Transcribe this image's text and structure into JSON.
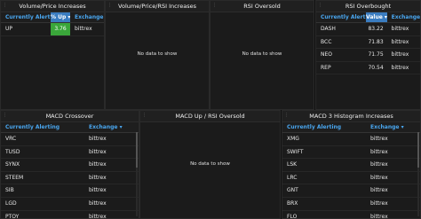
{
  "colors": {
    "accent": "#3a7cc0",
    "header_text": "#49a6ef",
    "positive": "#3aa63a"
  },
  "panels": {
    "vol_price": {
      "title": "Volume/Price Increases",
      "col1": "Currently Alerting",
      "col2": "% Up ▾",
      "col3": "Exchange",
      "rows": [
        {
          "coin": "UP",
          "value": "3.76",
          "exchange": "bittrex"
        }
      ]
    },
    "vol_price_rsi": {
      "title": "Volume/Price/RSI Increases",
      "empty": "No data to show"
    },
    "rsi_oversold": {
      "title": "RSI Oversold",
      "empty": "No data to show"
    },
    "rsi_overbought": {
      "title": "RSI Overbought",
      "col1": "Currently Alerting",
      "col2": "Value ▾",
      "col3": "Exchange",
      "rows": [
        {
          "coin": "DASH",
          "value": "83.22",
          "exchange": "bittrex"
        },
        {
          "coin": "BCC",
          "value": "71.83",
          "exchange": "bittrex"
        },
        {
          "coin": "NEO",
          "value": "71.75",
          "exchange": "bittrex"
        },
        {
          "coin": "REP",
          "value": "70.54",
          "exchange": "bittrex"
        }
      ]
    },
    "macd_crossover": {
      "title": "MACD Crossover",
      "col1": "Currently Alerting",
      "col2": "Exchange ▾",
      "rows": [
        {
          "coin": "VRC",
          "exchange": "bittrex"
        },
        {
          "coin": "TUSD",
          "exchange": "bittrex"
        },
        {
          "coin": "SYNX",
          "exchange": "bittrex"
        },
        {
          "coin": "STEEM",
          "exchange": "bittrex"
        },
        {
          "coin": "SIB",
          "exchange": "bittrex"
        },
        {
          "coin": "LGD",
          "exchange": "bittrex"
        },
        {
          "coin": "PTOY",
          "exchange": "bittrex"
        }
      ]
    },
    "macd_up_rsi": {
      "title": "MACD Up / RSI Oversold",
      "empty": "No data to show"
    },
    "macd3": {
      "title": "MACD 3 Histogram Increases",
      "col1": "Currently Alerting",
      "col2": "Exchange ▾",
      "rows": [
        {
          "coin": "XMG",
          "exchange": "bittrex"
        },
        {
          "coin": "SWIFT",
          "exchange": "bittrex"
        },
        {
          "coin": "LSK",
          "exchange": "bittrex"
        },
        {
          "coin": "LRC",
          "exchange": "bittrex"
        },
        {
          "coin": "GNT",
          "exchange": "bittrex"
        },
        {
          "coin": "BRX",
          "exchange": "bittrex"
        },
        {
          "coin": "FLO",
          "exchange": "bittrex"
        }
      ]
    }
  }
}
